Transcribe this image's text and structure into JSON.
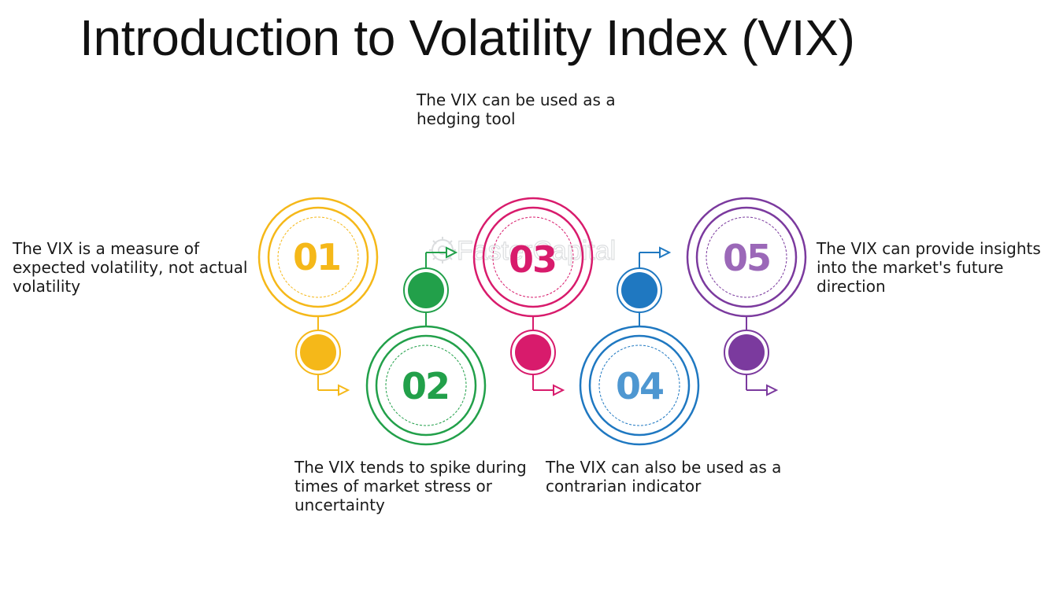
{
  "title": "Introduction to Volatility Index (VIX)",
  "watermark": "FasterCapital",
  "steps": [
    {
      "number": "01",
      "color": "#f5b819",
      "text": "The VIX is a measure of expected volatility, not actual volatility"
    },
    {
      "number": "02",
      "color": "#22a04a",
      "text": "The VIX tends to spike during times of market stress or uncertainty"
    },
    {
      "number": "03",
      "color": "#d81b6c",
      "text": "The VIX can be used as a hedging tool"
    },
    {
      "number": "04",
      "color": "#1f78c1",
      "text": "The VIX can also be used as a contrarian indicator"
    },
    {
      "number": "05",
      "color": "#7b3a9e",
      "text": "The VIX can provide insights into the market's future direction"
    }
  ]
}
